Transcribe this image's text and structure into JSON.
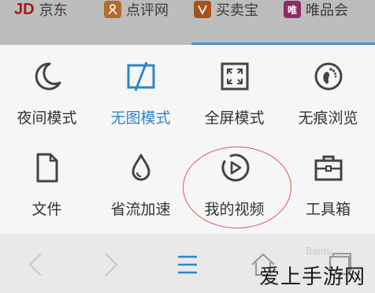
{
  "bookmarks": [
    {
      "icon": "jd-logo",
      "logo_text": "JD",
      "label": "京东"
    },
    {
      "icon": "dianping-logo",
      "logo_text": "",
      "label": "点评网"
    },
    {
      "icon": "maimaibao-logo",
      "logo_text": "",
      "label": "买卖宝"
    },
    {
      "icon": "vip-logo",
      "logo_text": "唯",
      "label": "唯品会"
    }
  ],
  "menu": {
    "items": [
      {
        "label": "夜间模式",
        "icon": "moon-icon"
      },
      {
        "label": "无图模式",
        "icon": "no-image-icon",
        "active": true
      },
      {
        "label": "全屏模式",
        "icon": "fullscreen-icon"
      },
      {
        "label": "无痕浏览",
        "icon": "footprint-icon"
      },
      {
        "label": "文件",
        "icon": "file-icon"
      },
      {
        "label": "省流加速",
        "icon": "drop-icon"
      },
      {
        "label": "我的视频",
        "icon": "video-icon"
      },
      {
        "label": "工具箱",
        "icon": "toolbox-icon"
      }
    ]
  },
  "bottom_bar": {
    "buttons": [
      "back-icon",
      "forward-icon",
      "menu-icon",
      "home-icon",
      "tabs-icon"
    ]
  },
  "watermark": {
    "text": "爱上手游网",
    "site": "Baidu"
  },
  "colors": {
    "accent": "#2f86c8",
    "highlight": "#e05555",
    "overlay": "#bdbdbd"
  }
}
